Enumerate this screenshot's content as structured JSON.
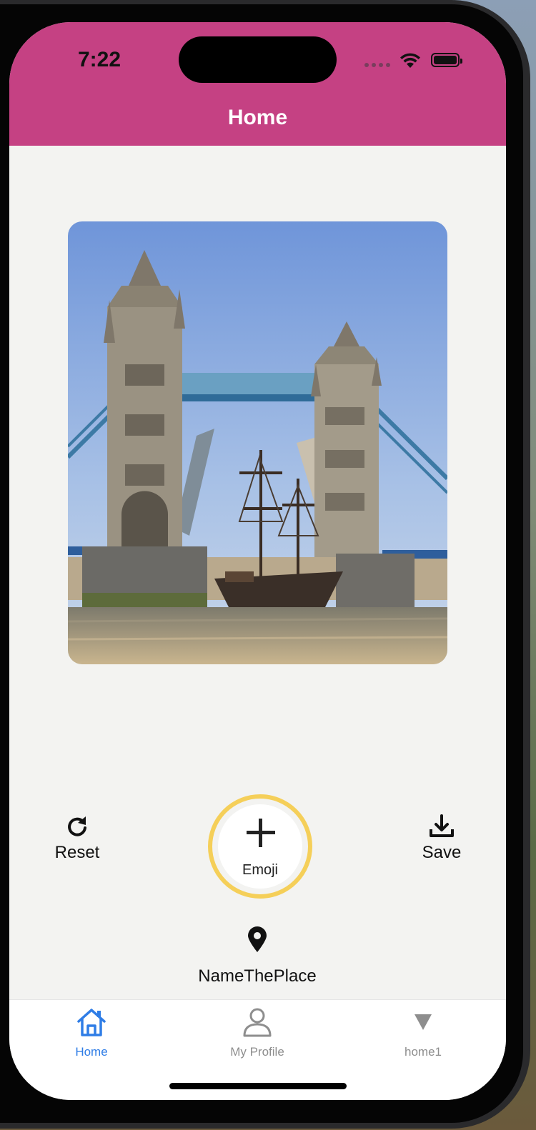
{
  "status_bar": {
    "time": "7:22"
  },
  "header": {
    "title": "Home"
  },
  "actions": {
    "reset_label": "Reset",
    "emoji_label": "Emoji",
    "save_label": "Save",
    "place_label": "NameThePlace"
  },
  "tabs": [
    {
      "label": "Home",
      "icon": "house-icon",
      "active": true
    },
    {
      "label": "My Profile",
      "icon": "person-icon",
      "active": false
    },
    {
      "label": "home1",
      "icon": "triangle-down-icon",
      "active": false
    }
  ],
  "colors": {
    "header": "#c54183",
    "emoji_ring": "#f5cf59",
    "tab_active": "#2f7de6",
    "tab_inactive": "#8e8e8e",
    "background": "#f3f3f1"
  }
}
